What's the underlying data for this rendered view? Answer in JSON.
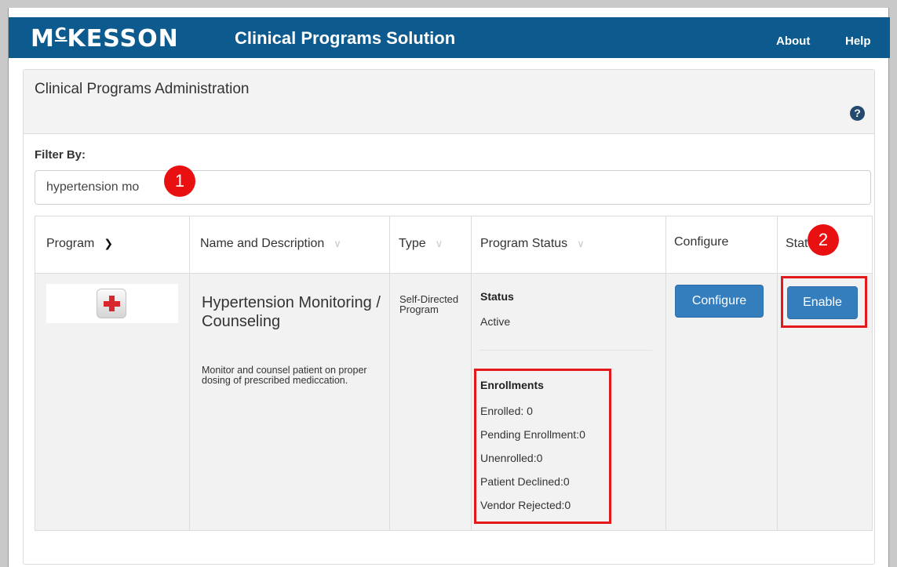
{
  "header": {
    "logo_main": "MC",
    "logo_sup": "",
    "logo_rest": "KESSON",
    "app_title": "Clinical Programs Solution",
    "nav": {
      "about": "About",
      "help": "Help"
    }
  },
  "panel": {
    "title": "Clinical Programs Administration",
    "help_icon_glyph": "?",
    "filter_label": "Filter By:",
    "filter_value": "hypertension mo"
  },
  "table": {
    "columns": {
      "program": "Program",
      "name_desc": "Name and Description",
      "type": "Type",
      "program_status": "Program Status",
      "configure": "Configure",
      "status": "Status"
    },
    "row": {
      "icon": "red-cross-icon",
      "name": "Hypertension Monitoring / Counseling",
      "description": "Monitor and counsel patient on proper dosing of prescribed mediccation.",
      "type": "Self-Directed Program",
      "status_heading": "Status",
      "status_value": "Active",
      "enrollments_heading": "Enrollments",
      "enrollments": [
        "Enrolled: 0",
        "Pending Enrollment:0",
        "Unenrolled:0",
        "Patient Declined:0",
        "Vendor Rejected:0"
      ],
      "configure_label": "Configure",
      "enable_label": "Enable"
    }
  },
  "callouts": {
    "one": "1",
    "two": "2"
  },
  "colors": {
    "header_bg": "#0d5a8e",
    "button_bg": "#357ebd",
    "highlight": "#e4191b",
    "callout": "#e81010"
  }
}
